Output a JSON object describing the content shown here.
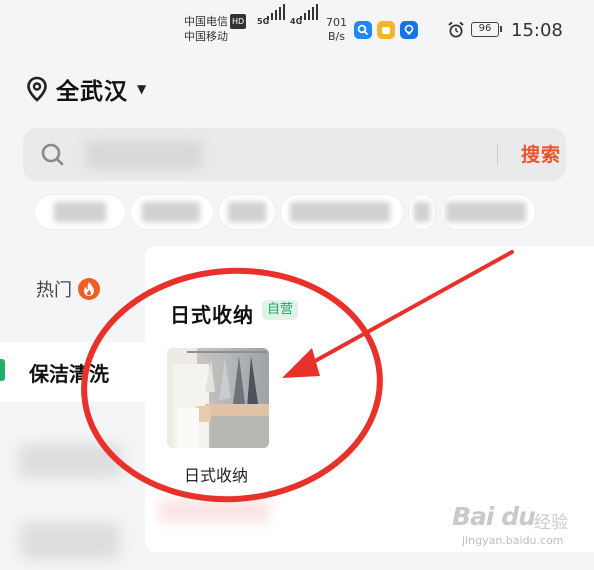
{
  "status_bar": {
    "carrier_top": "中国电信",
    "carrier_hd": "HD",
    "carrier_bottom": "中国移动",
    "net1": "5G",
    "net2": "4G",
    "speed_value": "701",
    "speed_unit": "B/s",
    "battery": "96",
    "time": "15:08",
    "app_icon_colors": [
      "#1e88f5",
      "#f7b32b",
      "#1673e8"
    ]
  },
  "location": {
    "icon": "location-pin-icon",
    "city": "全武汉",
    "caret": "▼"
  },
  "search": {
    "button_label": "搜索",
    "accent": "#f0502a"
  },
  "sidebar": {
    "items": [
      {
        "label": "热门",
        "icon": "fire-icon"
      },
      {
        "label": "保洁清洗",
        "active": true
      }
    ],
    "active_color": "#1fb06a"
  },
  "section": {
    "title": "日式收纳",
    "badge": "自营"
  },
  "product": {
    "name": "日式收纳"
  },
  "watermark": {
    "brand": "Bai du",
    "jingyan": "经验",
    "url": "jingyan.baidu.com"
  }
}
